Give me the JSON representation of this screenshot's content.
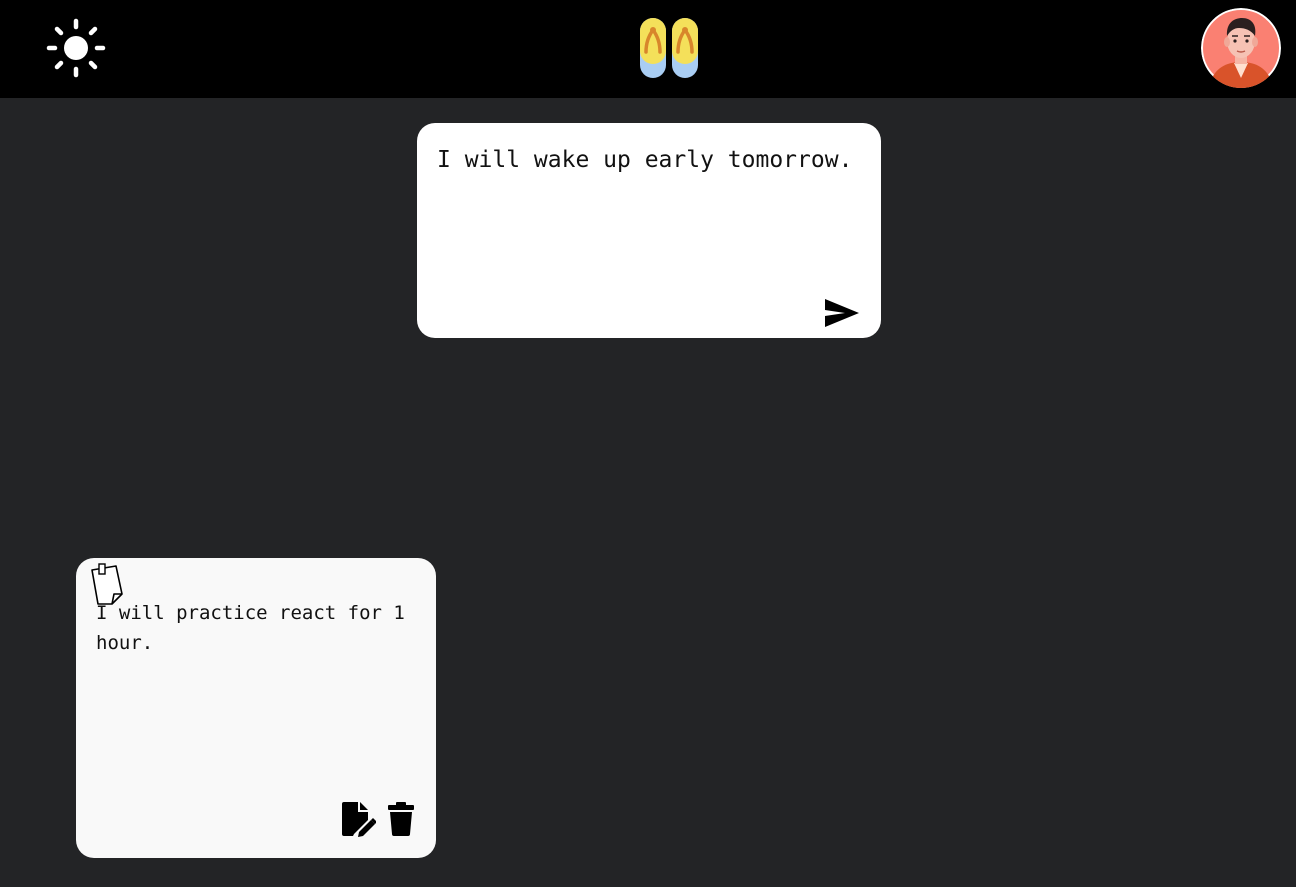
{
  "header": {
    "theme_toggle_icon": "sun-icon",
    "logo_icon": "flip-flops-icon",
    "avatar_icon": "user-avatar-icon"
  },
  "composer": {
    "text": "I will wake up early tomorrow.",
    "send_icon": "send-icon"
  },
  "notes": [
    {
      "text": "I will practice react for 1 hour.",
      "note_icon": "sticky-note-icon",
      "edit_icon": "edit-file-icon",
      "delete_icon": "trash-icon"
    }
  ],
  "colors": {
    "header_background": "#000000",
    "page_background": "#232426",
    "card_background": "#ffffff",
    "note_background": "#f9f9f9",
    "avatar_background": "#fa8072"
  }
}
